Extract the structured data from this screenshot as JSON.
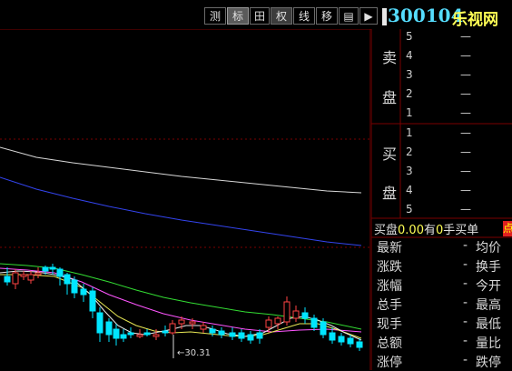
{
  "toolbar": {
    "buttons": [
      "测",
      "标",
      "田",
      "权",
      "线",
      "移",
      "▤",
      "▶"
    ],
    "stock_code": "300104",
    "stock_name": "乐视网"
  },
  "chart": {
    "annotation": "←30.31",
    "colors": {
      "up": "#ff4444",
      "down": "#00e5ff",
      "ma_white": "#e8e8e8",
      "ma_yellow": "#e8e855",
      "ma_magenta": "#ff55ff",
      "ma_green": "#33dd33",
      "long_white": "#d8d8d8",
      "long_blue": "#3344ee",
      "grid": "#7a0000"
    }
  },
  "order_book": {
    "sell_label_top": "卖",
    "sell_label_bottom": "盘",
    "buy_label_top": "买",
    "buy_label_bottom": "盘",
    "sell": [
      {
        "level": "5",
        "value": "—"
      },
      {
        "level": "4",
        "value": "—"
      },
      {
        "level": "3",
        "value": "—"
      },
      {
        "level": "2",
        "value": "—"
      },
      {
        "level": "1",
        "value": "—"
      }
    ],
    "buy": [
      {
        "level": "1",
        "value": "—"
      },
      {
        "level": "2",
        "value": "—"
      },
      {
        "level": "3",
        "value": "—"
      },
      {
        "level": "4",
        "value": "—"
      },
      {
        "level": "5",
        "value": "—"
      }
    ]
  },
  "trade_line": {
    "label1": "买盘",
    "num1": "0.00",
    "label2": "有",
    "num2": "0",
    "label3": "手买单",
    "badge": "点"
  },
  "stats": [
    {
      "left": "最新",
      "dash": "-",
      "right": "均价"
    },
    {
      "left": "涨跌",
      "dash": "-",
      "right": "换手"
    },
    {
      "left": "涨幅",
      "dash": "-",
      "right": "今开"
    },
    {
      "left": "总手",
      "dash": "-",
      "right": "最高"
    },
    {
      "left": "现手",
      "dash": "-",
      "right": "最低"
    },
    {
      "left": "总额",
      "dash": "-",
      "right": "量比"
    },
    {
      "left": "涨停",
      "dash": "-",
      "right": "跌停"
    }
  ]
}
